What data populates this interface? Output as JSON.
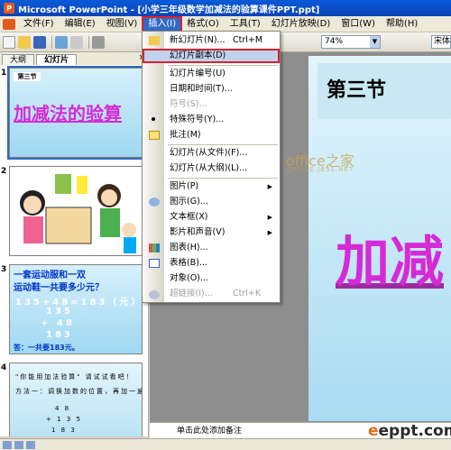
{
  "window": {
    "title": "Microsoft PowerPoint - [小学三年级数学加减法的验算课件PPT.ppt]"
  },
  "menubar": {
    "items": [
      "文件(F)",
      "编辑(E)",
      "视图(V)",
      "插入(I)",
      "格式(O)",
      "工具(T)",
      "幻灯片放映(D)",
      "窗口(W)",
      "帮助(H)"
    ],
    "active_index": 3
  },
  "toolbar": {
    "zoom_value": "74%",
    "font_value": "宋体"
  },
  "panel_tabs": {
    "outline": "大纲",
    "slides": "幻灯片",
    "close": "×"
  },
  "insert_menu": {
    "items": [
      {
        "label": "新幻灯片(N)...",
        "shortcut": "Ctrl+M",
        "icon": "new-slide-icon",
        "disabled": false
      },
      {
        "label": "幻灯片副本(D)",
        "highlighted": true,
        "disabled": false
      },
      {
        "label": "幻灯片编号(U)",
        "disabled": false
      },
      {
        "label": "日期和时间(T)...",
        "disabled": false
      },
      {
        "label": "符号(S)...",
        "disabled": true
      },
      {
        "label": "特殊符号(Y)...",
        "disabled": false
      },
      {
        "label": "批注(M)",
        "icon": "comment-icon",
        "disabled": false
      },
      {
        "label": "幻灯片(从文件)(F)...",
        "disabled": false
      },
      {
        "label": "幻灯片(从大纲)(L)...",
        "disabled": false
      },
      {
        "label": "图片(P)",
        "submenu": true,
        "disabled": false
      },
      {
        "label": "图示(G)...",
        "icon": "diagram-icon",
        "disabled": false
      },
      {
        "label": "文本框(X)",
        "submenu": true,
        "disabled": false
      },
      {
        "label": "影片和声音(V)",
        "submenu": true,
        "disabled": false
      },
      {
        "label": "图表(H)...",
        "icon": "chart-icon",
        "disabled": false
      },
      {
        "label": "表格(B)...",
        "icon": "table-icon",
        "disabled": false
      },
      {
        "label": "对象(O)...",
        "disabled": false
      },
      {
        "label": "超链接(I)...",
        "shortcut": "Ctrl+K",
        "icon": "hyperlink-icon",
        "disabled": true
      }
    ]
  },
  "slides": [
    {
      "number": "1",
      "header": "第三节",
      "title": "加减法的验算"
    },
    {
      "number": "2"
    },
    {
      "number": "3",
      "line1": "一套运动服和一双",
      "line2": "运动鞋一共要多少元？",
      "eq": "135+48=183（元）",
      "v1": "135",
      "v2": "+ 48",
      "v3": "183",
      "answer": "答：一共要183元。"
    },
    {
      "number": "4",
      "line1": "\"你能用加法验算\" 请试试看吧！",
      "line2": "方法一：调换加数的位置，再加一遍。",
      "a": "4 8",
      "b": "+ 1 3 5",
      "c": "1 8 3"
    }
  ],
  "main_slide": {
    "header": "第三节",
    "title": "加减"
  },
  "watermark": {
    "text": "office之家",
    "sub": "OFFICE.JB51.NET"
  },
  "notes": {
    "placeholder": "单击此处添加备注"
  },
  "site_logo": {
    "e": "e",
    "rest": "eppt.com"
  }
}
